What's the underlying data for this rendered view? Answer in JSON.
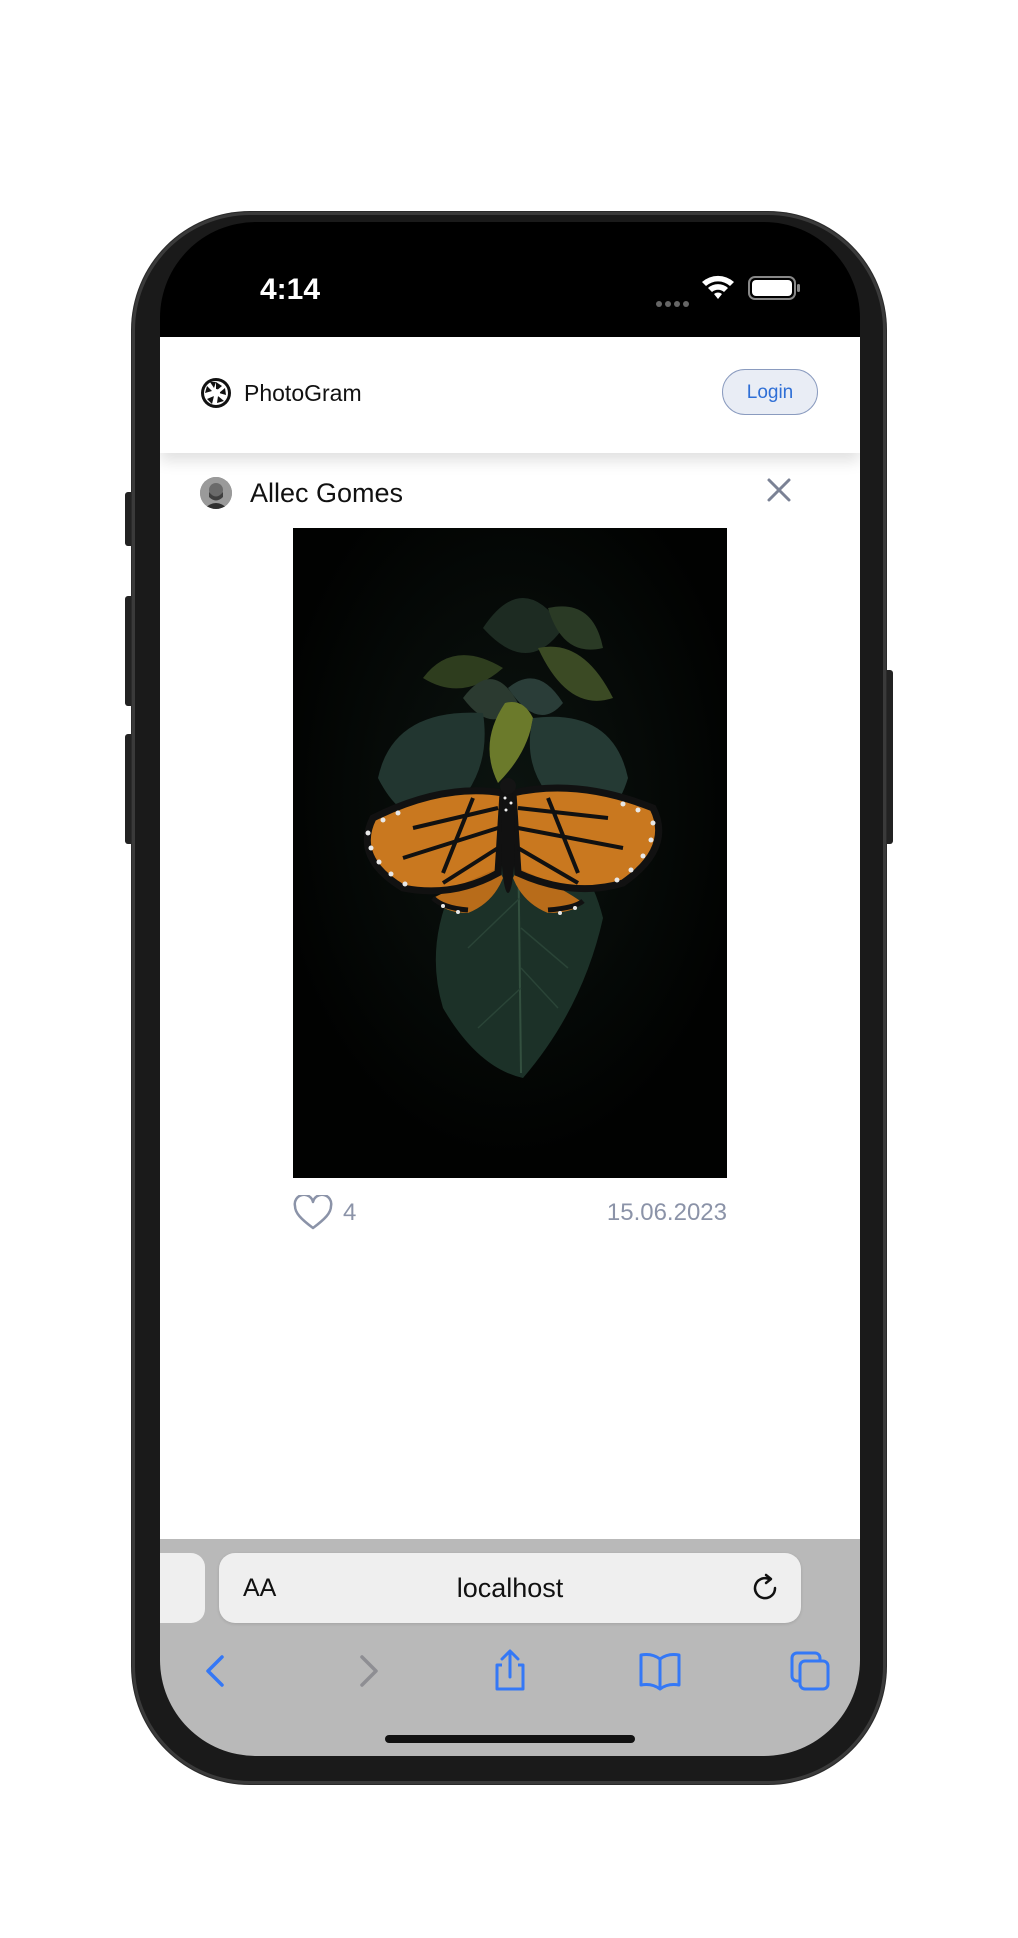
{
  "status_bar": {
    "time": "4:14"
  },
  "navbar": {
    "brand_name": "PhotoGram",
    "login_label": "Login"
  },
  "post": {
    "author": "Allec Gomes",
    "likes": "4",
    "date": "15.06.2023",
    "image": "monarch-butterfly-on-leaf"
  },
  "safari": {
    "text_size_label": "AA",
    "url": "localhost",
    "toolbar_icons": [
      "back-icon",
      "forward-icon",
      "share-icon",
      "bookmarks-icon",
      "tabs-icon"
    ]
  },
  "colors": {
    "accent": "#2f6fd6",
    "safari_icon": "#3478f6",
    "muted_text": "#8b93a8",
    "safari_bar": "#b9b9b9"
  }
}
